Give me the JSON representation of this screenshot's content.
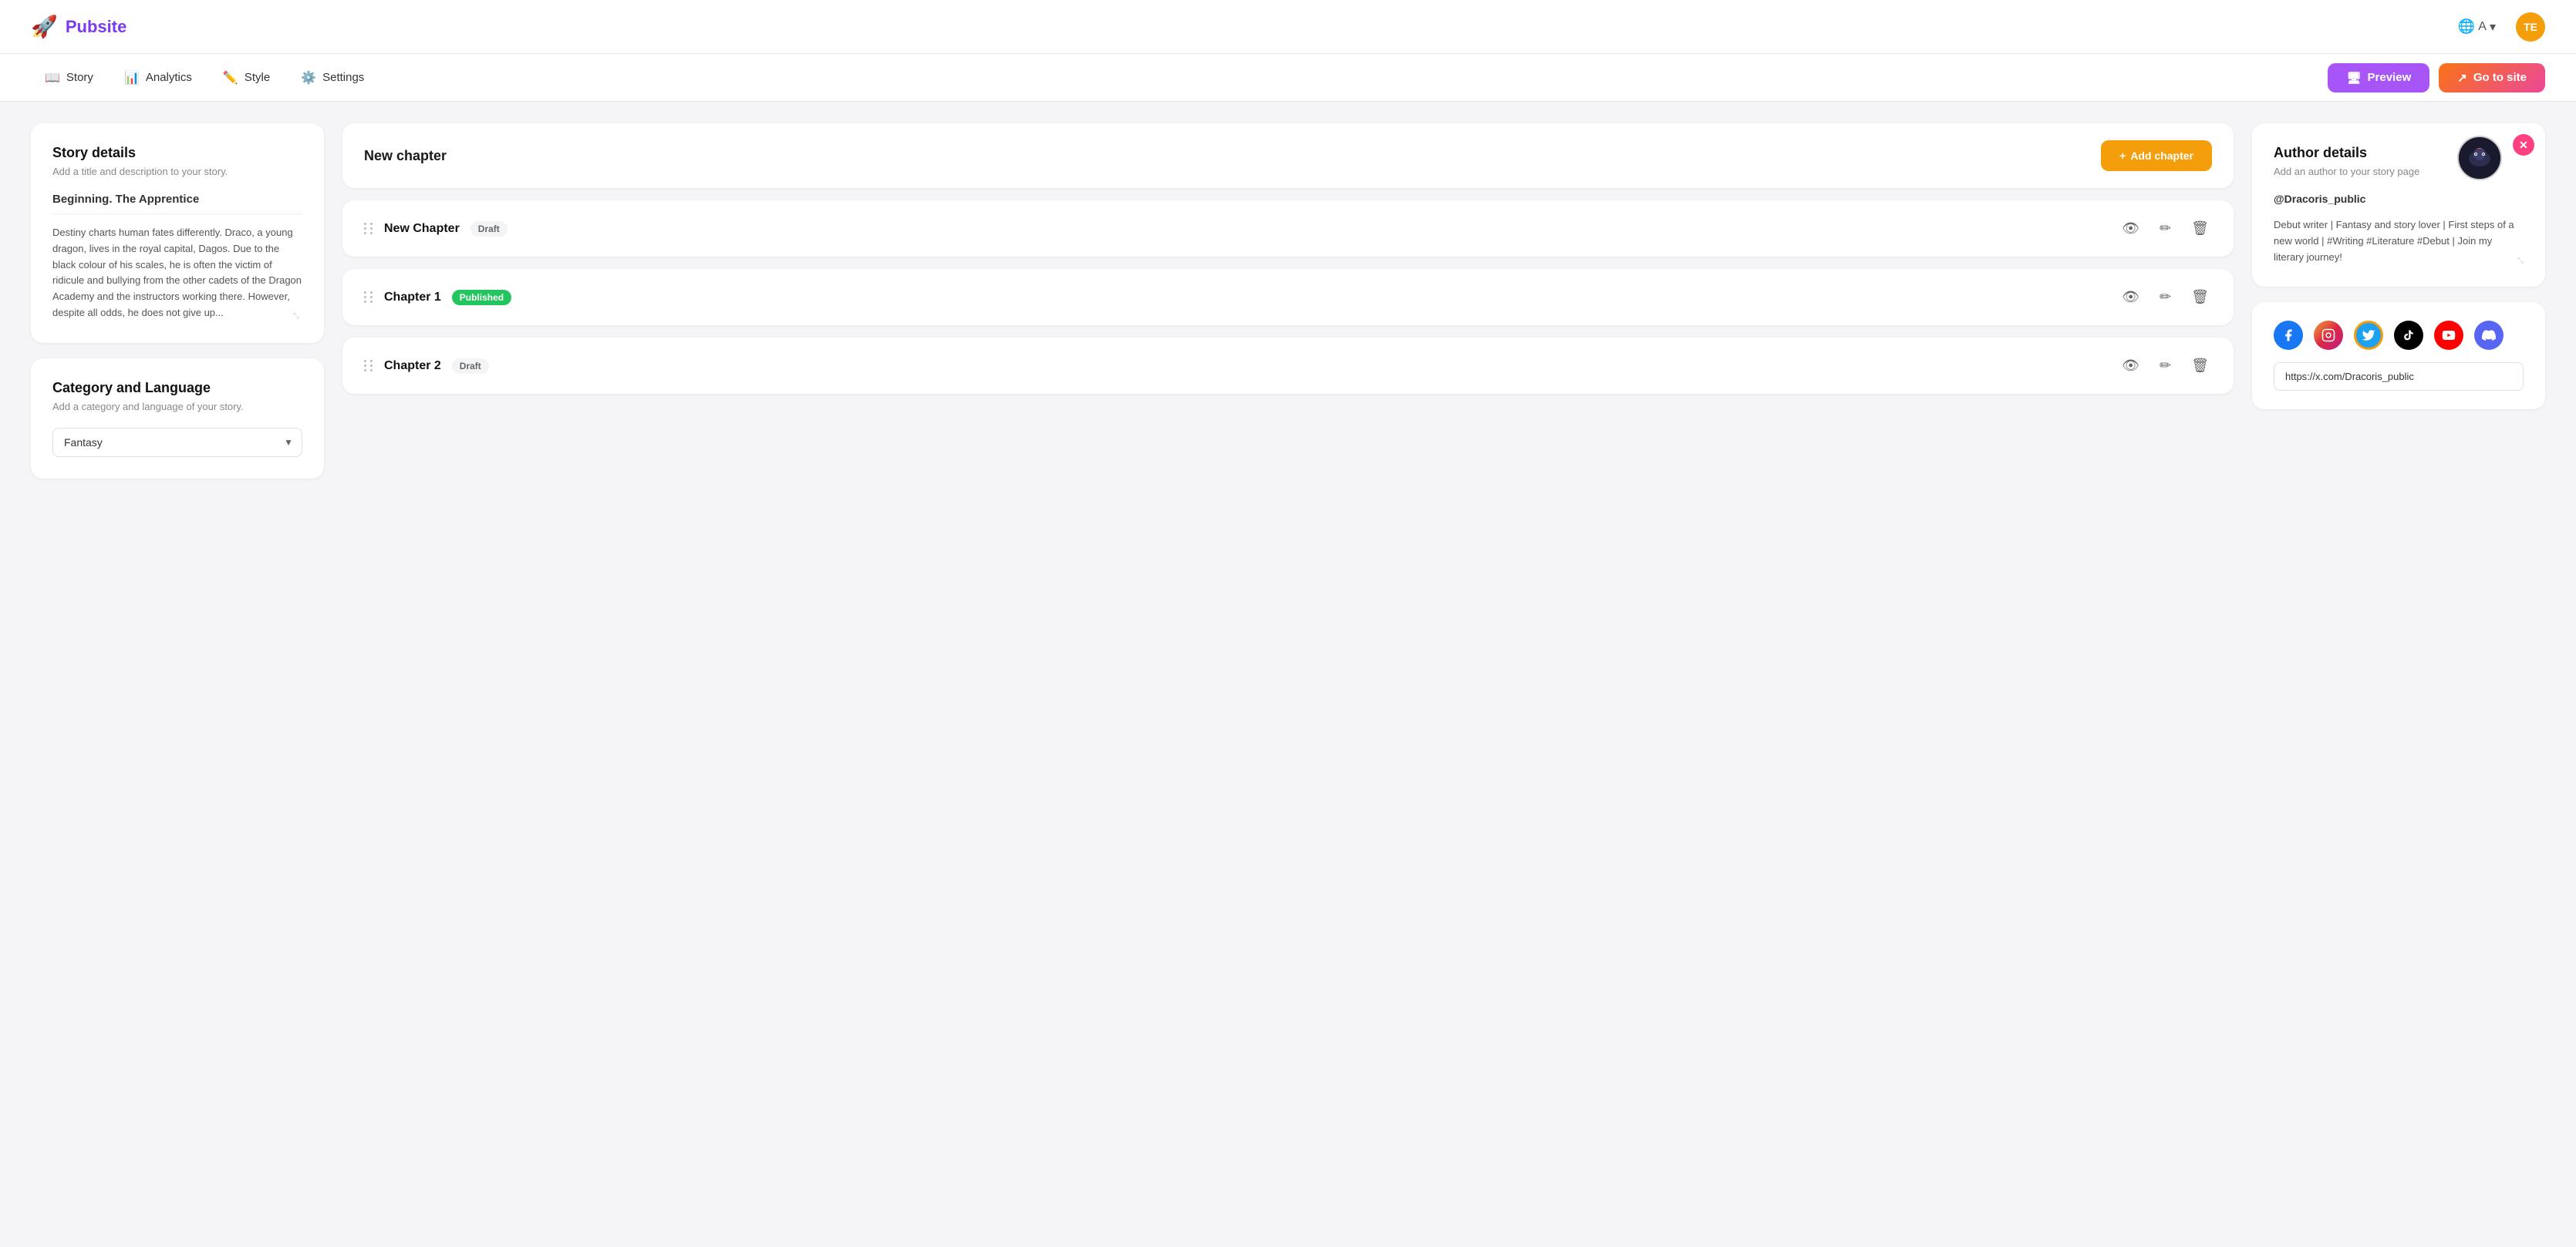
{
  "app": {
    "logo_icon": "🚀",
    "logo_text": "Pubsite",
    "lang_label": "A",
    "lang_chevron": "▾",
    "avatar_initials": "TE"
  },
  "nav": {
    "items": [
      {
        "id": "story",
        "icon": "📖",
        "label": "Story"
      },
      {
        "id": "analytics",
        "icon": "📊",
        "label": "Analytics"
      },
      {
        "id": "style",
        "icon": "✏️",
        "label": "Style"
      },
      {
        "id": "settings",
        "icon": "⚙️",
        "label": "Settings"
      }
    ],
    "preview_label": "Preview",
    "goto_label": "Go to site"
  },
  "story_details": {
    "title": "Story details",
    "subtitle": "Add a title and description to your story.",
    "story_title": "Beginning. The Apprentice",
    "description": "Destiny charts human fates differently. Draco, a young dragon, lives in the royal capital, Dagos. Due to the black colour of his scales, he is often the victim of ridicule and bullying from the other cadets of the Dragon Academy and the instructors working there. However, despite all odds, he does not give up..."
  },
  "category": {
    "title": "Category and Language",
    "subtitle": "Add a category and language of your story.",
    "selected": "Fantasy"
  },
  "new_chapter": {
    "title": "New chapter",
    "add_button": "+ Add chapter"
  },
  "chapters": [
    {
      "id": "new-chapter",
      "name": "New Chapter",
      "status": "Draft",
      "status_type": "draft"
    },
    {
      "id": "chapter-1",
      "name": "Chapter 1",
      "status": "Published",
      "status_type": "published"
    },
    {
      "id": "chapter-2",
      "name": "Chapter 2",
      "status": "Draft",
      "status_type": "draft"
    }
  ],
  "author_details": {
    "title": "Author details",
    "subtitle": "Add an author to your story page",
    "avatar_icon": "🐉",
    "username": "@Dracoris_public",
    "bio": "Debut writer | Fantasy and story lover | First steps of a new world | #Writing #Literature #Debut | Join my literary journey!"
  },
  "social": {
    "icons": [
      {
        "id": "facebook",
        "symbol": "f",
        "class": "si-facebook"
      },
      {
        "id": "instagram",
        "symbol": "📷",
        "class": "si-instagram"
      },
      {
        "id": "twitter",
        "symbol": "🐦",
        "class": "si-twitter"
      },
      {
        "id": "tiktok",
        "symbol": "♪",
        "class": "si-tiktok"
      },
      {
        "id": "youtube",
        "symbol": "▶",
        "class": "si-youtube"
      },
      {
        "id": "discord",
        "symbol": "💬",
        "class": "si-discord"
      }
    ],
    "url": "https://x.com/Dracoris_public"
  },
  "icons": {
    "preview": "🖥",
    "goto": "↗",
    "eye": "👁",
    "edit": "✏",
    "trash": "🗑",
    "close": "✕",
    "drag": "⋮⋮"
  }
}
